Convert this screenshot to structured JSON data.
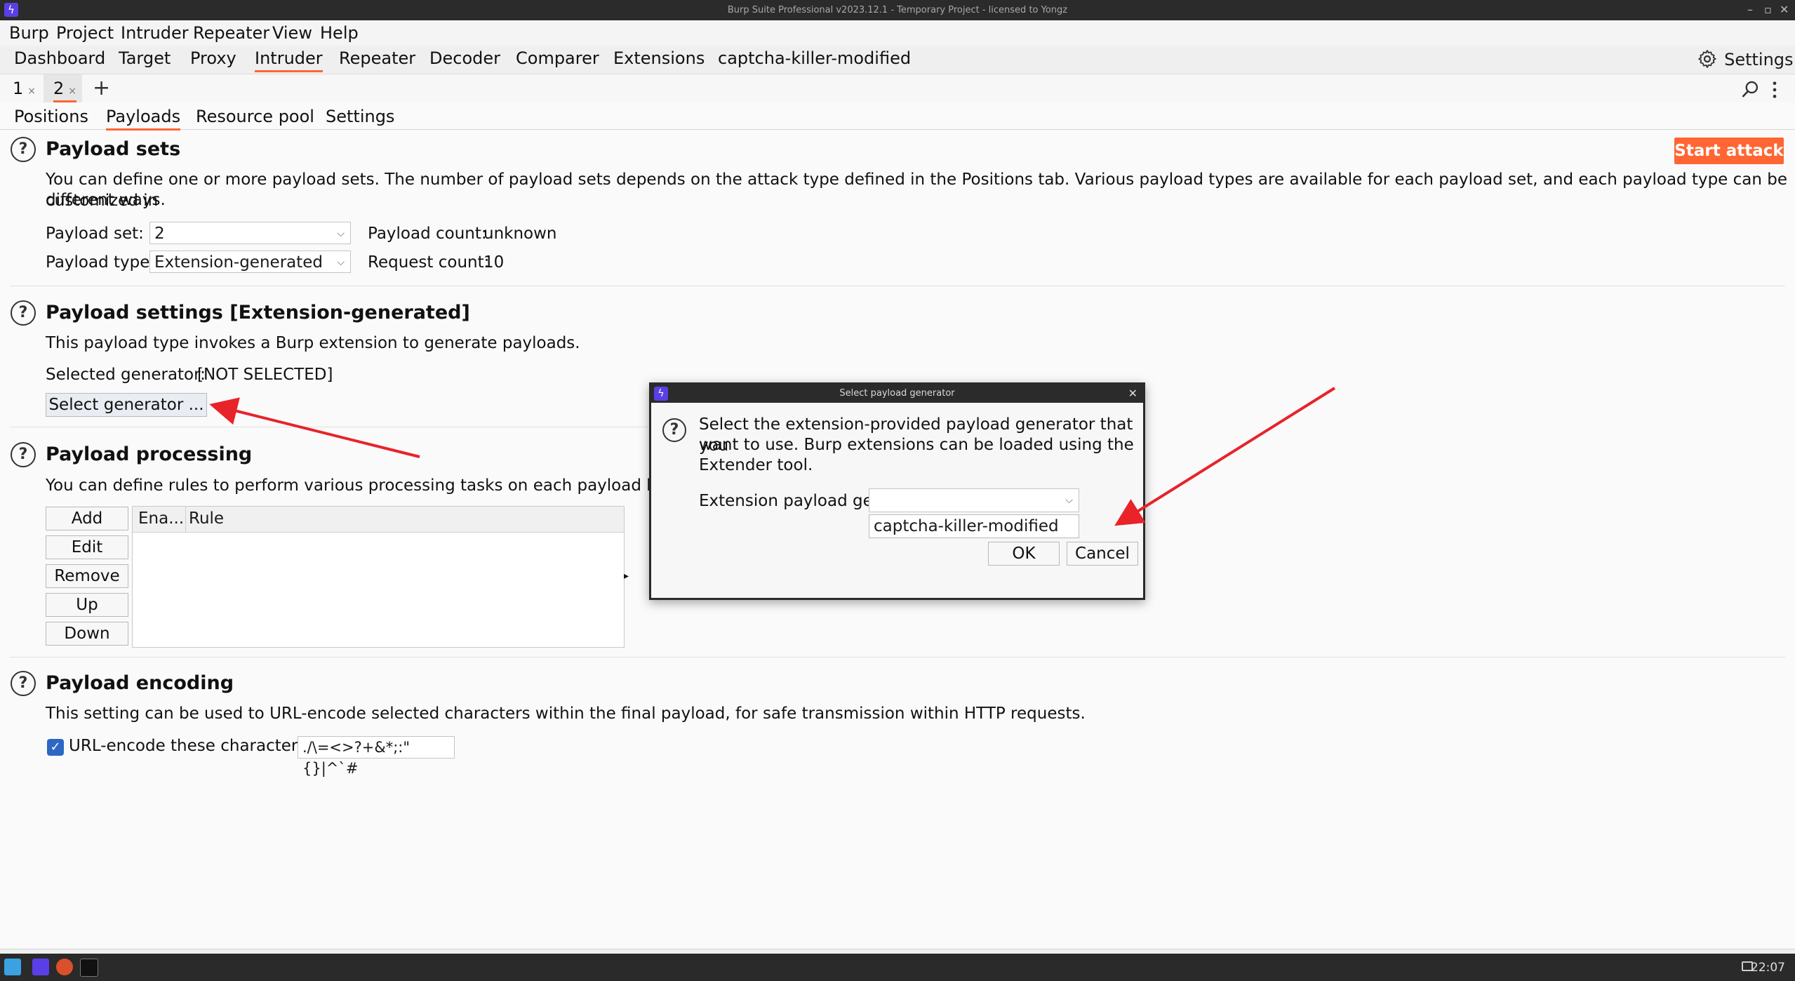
{
  "window": {
    "title": "Burp Suite Professional v2023.12.1 - Temporary Project - licensed to Yongz"
  },
  "menu": [
    "Burp",
    "Project",
    "Intruder",
    "Repeater",
    "View",
    "Help"
  ],
  "top_tabs": [
    "Dashboard",
    "Target",
    "Proxy",
    "Intruder",
    "Repeater",
    "Decoder",
    "Comparer",
    "Extensions",
    "captcha-killer-modified"
  ],
  "settings_label": "Settings",
  "instance_tabs": [
    "1",
    "2"
  ],
  "sub_tabs": [
    "Positions",
    "Payloads",
    "Resource pool",
    "Settings"
  ],
  "start_attack": "Start attack",
  "payload_sets": {
    "title": "Payload sets",
    "desc_line1": "You can define one or more payload sets. The number of payload sets depends on the attack type defined in the Positions tab. Various payload types are available for each payload set, and each payload type can be customized in",
    "desc_line2": "different ways.",
    "set_label": "Payload set:",
    "set_value": "2",
    "type_label": "Payload type:",
    "type_value": "Extension-generated",
    "count_label": "Payload count:",
    "count_value": "unknown",
    "request_label": "Request count:",
    "request_value": "10"
  },
  "payload_settings": {
    "title": "Payload settings [Extension-generated]",
    "desc": "This payload type invokes a Burp extension to generate payloads.",
    "selected_label": "Selected generator:",
    "selected_value": "[NOT SELECTED]",
    "select_button": "Select generator ..."
  },
  "payload_processing": {
    "title": "Payload processing",
    "desc": "You can define rules to perform various processing tasks on each payload before",
    "buttons": [
      "Add",
      "Edit",
      "Remove",
      "Up",
      "Down"
    ],
    "columns": [
      "Ena...",
      "Rule"
    ]
  },
  "payload_encoding": {
    "title": "Payload encoding",
    "desc": "This setting can be used to URL-encode selected characters within the final payload, for safe transmission within HTTP requests.",
    "checkbox_label": "URL-encode these characters:",
    "characters": "./\\=<>?+&*;:\"{}|^`#"
  },
  "dialog": {
    "title": "Select payload generator",
    "message_line1": "Select the extension-provided payload generator that you",
    "message_line2": "want to use. Burp extensions can be loaded using the",
    "message_line3": "Extender tool.",
    "generator_label": "Extension payload generator:",
    "option": "captcha-killer-modified",
    "ok": "OK",
    "cancel": "Cancel"
  },
  "taskbar": {
    "clock": "22:07"
  },
  "colors": {
    "accent": "#ff6633",
    "burp_purple": "#5b3fe6",
    "arrow_red": "#e8232a",
    "checkbox_blue": "#2d67c4"
  }
}
